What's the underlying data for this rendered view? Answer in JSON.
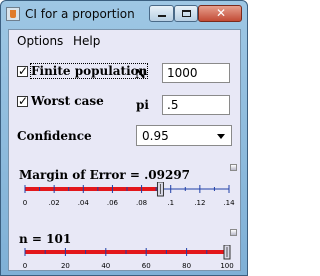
{
  "window": {
    "title": "CI for a proportion"
  },
  "menu": {
    "options": "Options",
    "help": "Help"
  },
  "finite_population": {
    "label": "Finite population",
    "checked": true
  },
  "worst_case": {
    "label": "Worst case",
    "checked": true
  },
  "fields": {
    "N_label": "N",
    "N_value": "1000",
    "pi_label": "pi",
    "pi_value": ".5"
  },
  "confidence": {
    "label": "Confidence",
    "value": "0.95"
  },
  "margin_slider": {
    "label": "Margin of Error = .09297",
    "value": 0.09297,
    "min": 0,
    "max": 0.14,
    "tick_labels": [
      "0",
      ".02",
      ".04",
      ".06",
      ".08",
      ".1",
      ".12",
      ".14"
    ]
  },
  "n_slider": {
    "label": "n = 101",
    "value": 101,
    "min": 0,
    "max": 100,
    "tick_labels": [
      "0",
      "20",
      "40",
      "60",
      "80",
      "100"
    ]
  },
  "colors": {
    "slider_fill": "#e3171b",
    "slider_track": "#1f3fa8",
    "panel_bg": "#e8e8f6"
  }
}
